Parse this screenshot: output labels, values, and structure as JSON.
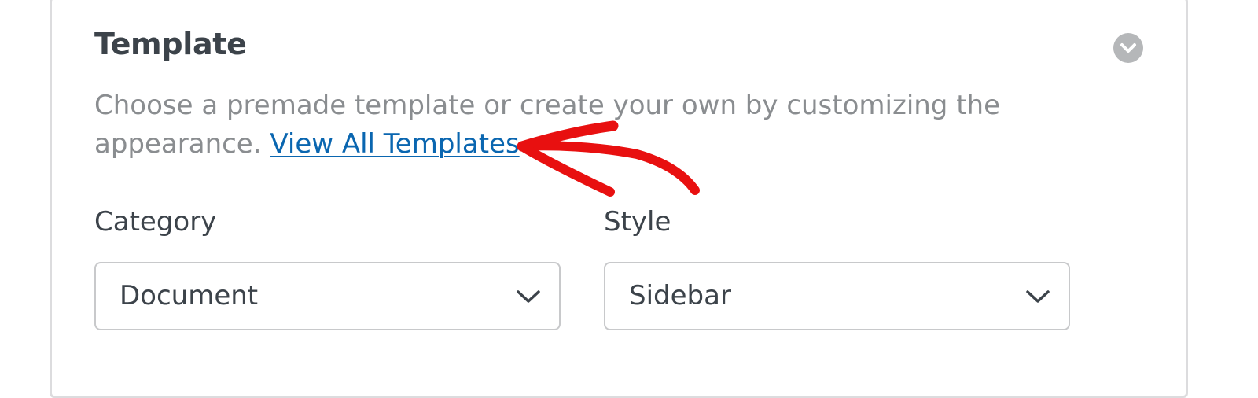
{
  "template_section": {
    "title": "Template",
    "description_text": "Choose a premade template or create your own by customizing the appearance.",
    "link_text": "View All Templates"
  },
  "category": {
    "label": "Category",
    "selected": "Document"
  },
  "style": {
    "label": "Style",
    "selected": "Sidebar"
  },
  "colors": {
    "link": "#0a66b0",
    "annotation": "#e81010",
    "collapse_button": "#b5b7b9"
  },
  "icons": {
    "collapse": "chevron-down-circle-icon",
    "select_chevron": "chevron-down-icon",
    "annotation": "hand-drawn-arrow-icon"
  }
}
